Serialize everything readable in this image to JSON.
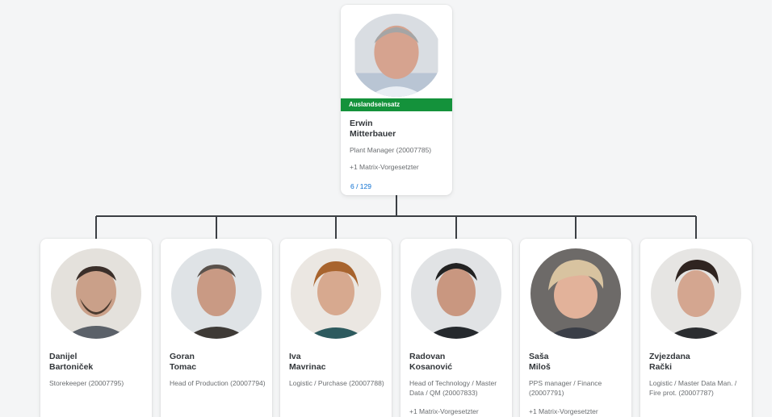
{
  "manager": {
    "status": "Auslandseinsatz",
    "first_name": "Erwin",
    "last_name": "Mitterbauer",
    "role": "Plant Manager (20007785)",
    "matrix": "+1 Matrix-Vorgesetzter",
    "count": "6 / 129"
  },
  "reports": [
    {
      "first_name": "Danijel",
      "last_name": "Bartoniček",
      "role": "Storekeeper (20007795)",
      "matrix": ""
    },
    {
      "first_name": "Goran",
      "last_name": "Tomac",
      "role": "Head of Production (20007794)",
      "matrix": ""
    },
    {
      "first_name": "Iva",
      "last_name": "Mavrinac",
      "role": "Logistic / Purchase (20007788)",
      "matrix": ""
    },
    {
      "first_name": "Radovan",
      "last_name": "Kosanović",
      "role": "Head of Technology / Master Data / QM (20007833)",
      "matrix": "+1 Matrix-Vorgesetzter"
    },
    {
      "first_name": "Saša",
      "last_name": "Miloš",
      "role": "PPS manager / Finance (20007791)",
      "matrix": "+1 Matrix-Vorgesetzter"
    },
    {
      "first_name": "Zvjezdana",
      "last_name": "Rački",
      "role": "Logistic / Master Data Man. / Fire prot. (20007787)",
      "matrix": ""
    }
  ],
  "colors": {
    "status_green": "#14923b",
    "link_blue": "#0a6ed1",
    "connector": "#3b3f44",
    "background": "#f4f5f6"
  }
}
